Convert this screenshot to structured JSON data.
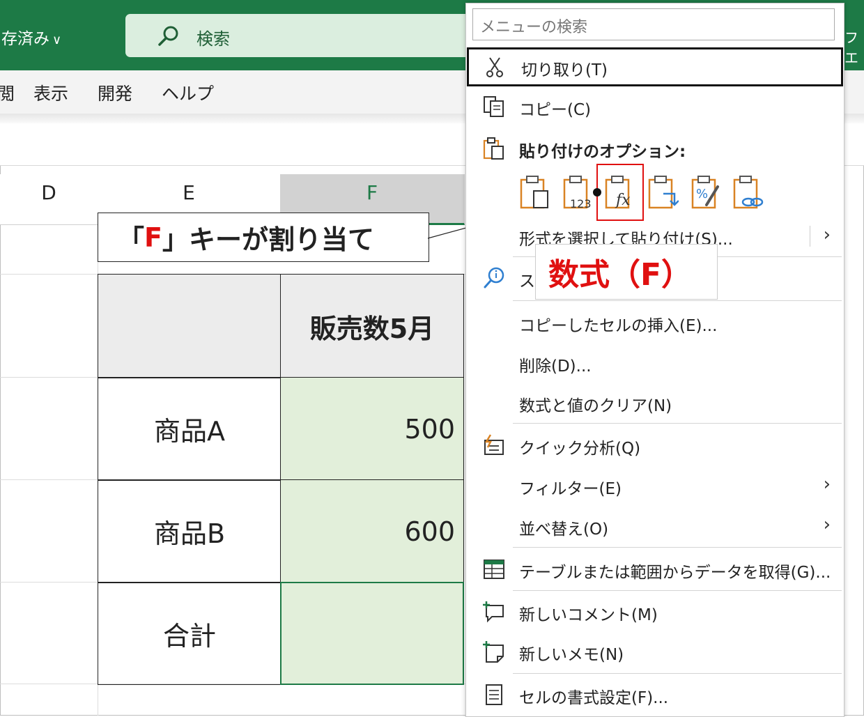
{
  "titlebar": {
    "saved_label": "存済み",
    "search_label": "検索",
    "right_text": "フエ"
  },
  "ribbon": {
    "tabs": [
      "閲",
      "表示",
      "開発",
      "ヘルプ"
    ]
  },
  "columns": [
    "D",
    "E",
    "F"
  ],
  "table": {
    "header": {
      "label_col": "",
      "value_col": "販売数5月"
    },
    "rows": [
      {
        "label": "商品A",
        "value": "500"
      },
      {
        "label": "商品B",
        "value": "600"
      },
      {
        "label": "合計",
        "value": ""
      }
    ]
  },
  "callout": {
    "open": "「",
    "key": "F",
    "close": "」",
    "rest": "キーが割り当て"
  },
  "menu": {
    "search_placeholder": "メニューの検索",
    "cut": "切り取り(T)",
    "copy": "コピー(C)",
    "paste_options": "貼り付けのオプション:",
    "paste_special": "形式を選択して貼り付け(S)...",
    "smart_lookup": "ス",
    "insert_copied": "コピーしたセルの挿入(E)...",
    "delete": "削除(D)...",
    "clear": "数式と値のクリア(N)",
    "quick_analysis": "クイック分析(Q)",
    "filter": "フィルター(E)",
    "sort": "並べ替え(O)",
    "get_data": "テーブルまたは範囲からデータを取得(G)...",
    "new_comment": "新しいコメント(M)",
    "new_note": "新しいメモ(N)",
    "format_cells": "セルの書式設定(F)..."
  },
  "formula_label": "数式（F）",
  "paste_icon_text": {
    "values": "123",
    "formula": "fx",
    "percent": "%"
  },
  "colors": {
    "excel_green": "#1d7a46",
    "highlight_red": "#e01010",
    "selected_cell_fill": "#e2efda"
  }
}
